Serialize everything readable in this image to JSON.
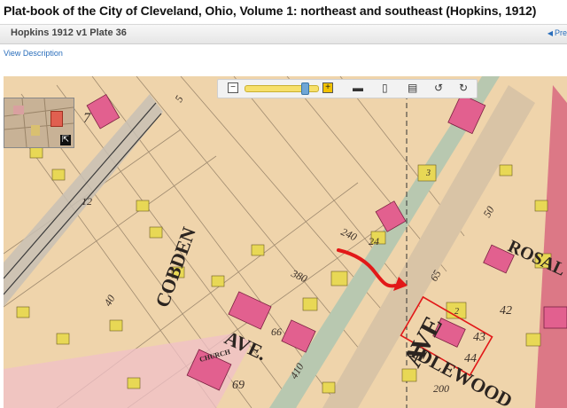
{
  "page": {
    "title": "Plat-book of the City of Cleveland, Ohio, Volume 1: northeast and southeast (Hopkins, 1912)",
    "plate_title": "Hopkins 1912 v1 Plate 36",
    "prev_label": "Pre",
    "view_description": "View Description"
  },
  "toolbar": {
    "zoom_out": "−",
    "zoom_in": "+",
    "zoom_level": 0.85
  },
  "map": {
    "street_labels": [
      "COBDEN",
      "AVE.",
      "AVE",
      "ROSAL",
      "IDLEWOOD"
    ],
    "lot_numbers": [
      "380",
      "240",
      "24",
      "65",
      "50",
      "42",
      "43",
      "44",
      "40",
      "69",
      "200",
      "410",
      "66",
      "7",
      "12",
      "3",
      "2",
      "5"
    ],
    "church_label": "CHURCH"
  }
}
